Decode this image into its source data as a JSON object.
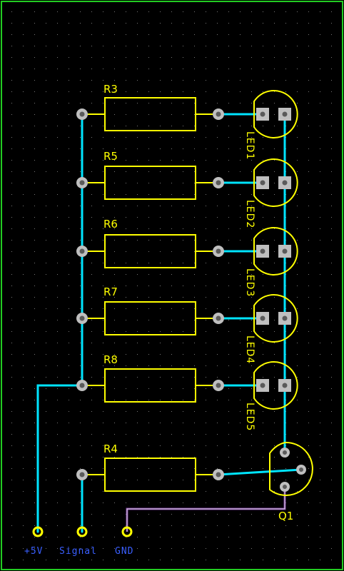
{
  "board": {
    "colors": {
      "background": "#000000",
      "outline": "#22cc22",
      "grid": "#777777",
      "trace": "#00e5ff",
      "silkscreen": "#ffff00",
      "pad": "#bfbfbf",
      "hole": "#5a5a5a",
      "jumper": "#e070e0",
      "connector": "#ffff00",
      "net_label": "#3a5fff"
    },
    "resistors": [
      {
        "ref": "R3"
      },
      {
        "ref": "R5"
      },
      {
        "ref": "R6"
      },
      {
        "ref": "R7"
      },
      {
        "ref": "R8"
      },
      {
        "ref": "R4"
      }
    ],
    "leds": [
      {
        "ref": "LED1"
      },
      {
        "ref": "LED2"
      },
      {
        "ref": "LED3"
      },
      {
        "ref": "LED4"
      },
      {
        "ref": "LED5"
      }
    ],
    "transistor": {
      "ref": "Q1"
    },
    "connectors": [
      {
        "label": "+5V"
      },
      {
        "label": "Signal"
      },
      {
        "label": "GND"
      }
    ]
  }
}
